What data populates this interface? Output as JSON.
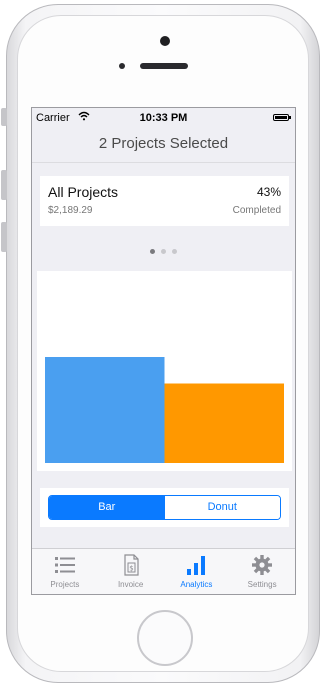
{
  "status_bar": {
    "carrier": "Carrier",
    "wifi_icon": "wifi-icon",
    "time": "10:33 PM",
    "battery_icon": "battery-icon"
  },
  "nav": {
    "title": "2 Projects Selected"
  },
  "summary": {
    "name": "All Projects",
    "amount": "$2,189.29",
    "percent": "43%",
    "status": "Completed"
  },
  "pager": {
    "count": 3,
    "active": 0
  },
  "chart_data": {
    "type": "bar",
    "categories": [
      "",
      ""
    ],
    "values": [
      1.0,
      0.75
    ],
    "colors": [
      "#4a9ff0",
      "#ff9800"
    ],
    "xlabel": "",
    "ylabel": "",
    "grid": false
  },
  "segment": {
    "options": [
      "Bar",
      "Donut"
    ],
    "selected": "Bar",
    "accent": "#0a7aff"
  },
  "tabs": [
    {
      "label": "Projects",
      "icon": "list-icon",
      "active": false
    },
    {
      "label": "Invoice",
      "icon": "invoice-icon",
      "active": false
    },
    {
      "label": "Analytics",
      "icon": "bar-chart-icon",
      "active": true
    },
    {
      "label": "Settings",
      "icon": "gear-icon",
      "active": false
    }
  ]
}
